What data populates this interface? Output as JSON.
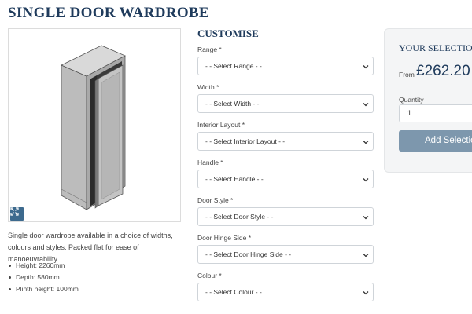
{
  "page": {
    "title": "SINGLE DOOR WARDROBE"
  },
  "product": {
    "image_alt": "Single door wardrobe",
    "expand_icon": "expand-icon",
    "description": "Single door wardrobe available in a choice of widths, colours and styles. Packed flat for ease of manoeuvrability.",
    "specs": [
      "Height: 2260mm",
      "Depth: 580mm",
      "Plinth height: 100mm"
    ]
  },
  "customise": {
    "heading": "CUSTOMISE",
    "fields": [
      {
        "label": "Range *",
        "selected": "- - Select Range - -"
      },
      {
        "label": "Width *",
        "selected": "- - Select Width - -"
      },
      {
        "label": "Interior Layout *",
        "selected": "- - Select Interior Layout - -"
      },
      {
        "label": "Handle *",
        "selected": "- - Select Handle - -"
      },
      {
        "label": "Door Style *",
        "selected": "- - Select Door Style - -"
      },
      {
        "label": "Door Hinge Side *",
        "selected": "- - Select Door Hinge Side - -"
      },
      {
        "label": "Colour *",
        "selected": "- - Select Colour - -"
      }
    ]
  },
  "selection": {
    "title": "YOUR SELECTION",
    "price_prefix": "From",
    "price": "£262.20",
    "quantity_label": "Quantity",
    "quantity_value": "1",
    "add_button_label": "Add Selection"
  },
  "colors": {
    "heading": "#1f3b5c",
    "button": "#7d97ad",
    "expand_button": "#3d6a8e",
    "panel_bg": "#f4f5f6"
  }
}
